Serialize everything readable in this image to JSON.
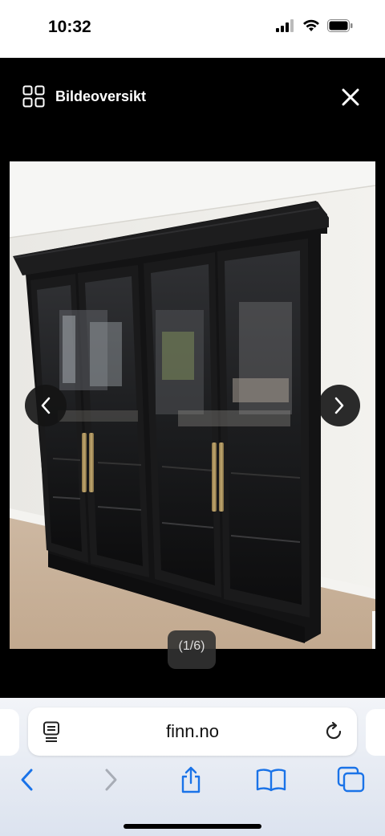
{
  "status_bar": {
    "time": "10:32",
    "icons": [
      "cellular-signal-icon",
      "wifi-icon",
      "battery-icon"
    ]
  },
  "viewer": {
    "overview_label": "Bildeoversikt",
    "overview_icon": "grid-icon",
    "close_icon": "close-icon",
    "prev_icon": "chevron-left-icon",
    "next_icon": "chevron-right-icon",
    "counter": "(1/6)"
  },
  "browser": {
    "url": "finn.no",
    "toolbar_icons": [
      "back-icon",
      "forward-icon",
      "share-icon",
      "bookmarks-icon",
      "tabs-icon"
    ]
  },
  "colors": {
    "accent": "#1a73e8",
    "viewer_background": "#000000"
  }
}
